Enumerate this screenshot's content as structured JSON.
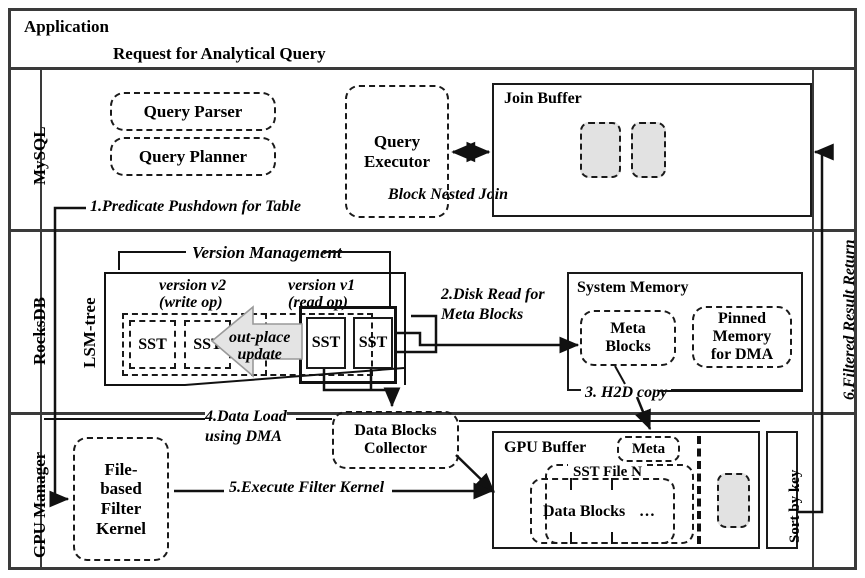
{
  "layers": {
    "application": {
      "title": "Application",
      "request": "Request for Analytical Query"
    },
    "mysql": {
      "side_label": "MySQL",
      "query_parser": "Query Parser",
      "query_planner": "Query Planner",
      "query_executor": "Query\nExecutor",
      "block_nested_join": "Block Nested Join",
      "join_buffer": "Join Buffer",
      "step1": "1.Predicate Pushdown for Table"
    },
    "rocksdb": {
      "side_label": "RocksDB",
      "lsm_label": "LSM-tree",
      "version_management": "Version Management",
      "version_v2": "version v2\n(write op)",
      "version_v1": "version v1\n(read op)",
      "out_place_update": "out-place\nupdate",
      "sst_labels": [
        "SST",
        "SST",
        "SST",
        "SST"
      ],
      "step2": "2.Disk Read  for\nMeta Blocks",
      "system_memory": "System Memory",
      "meta_blocks": "Meta\nBlocks",
      "pinned_memory": "Pinned\nMemory\nfor DMA",
      "step3": "3. H2D copy"
    },
    "gpu": {
      "side_label": "GPU Manager",
      "file_based_filter_kernel": "File-\nbased\nFilter\nKernel",
      "data_blocks_collector": "Data Blocks\nCollector",
      "step4": "4.Data Load\nusing DMA",
      "step5": "5.Execute Filter Kernel",
      "gpu_buffer": "GPU Buffer",
      "meta": "Meta",
      "sst_file_n": "SST File N",
      "data_blocks": "Data Blocks",
      "ellipsis": "…",
      "sort_by_key": "Sort by key"
    },
    "return_path": {
      "step6": "6.Filtered Result Return"
    }
  },
  "colors": {
    "frame": "#3a3a3a",
    "line": "#111111",
    "shaded_block": "#e2e2e2",
    "background": "#ffffff",
    "text": "#000000"
  }
}
